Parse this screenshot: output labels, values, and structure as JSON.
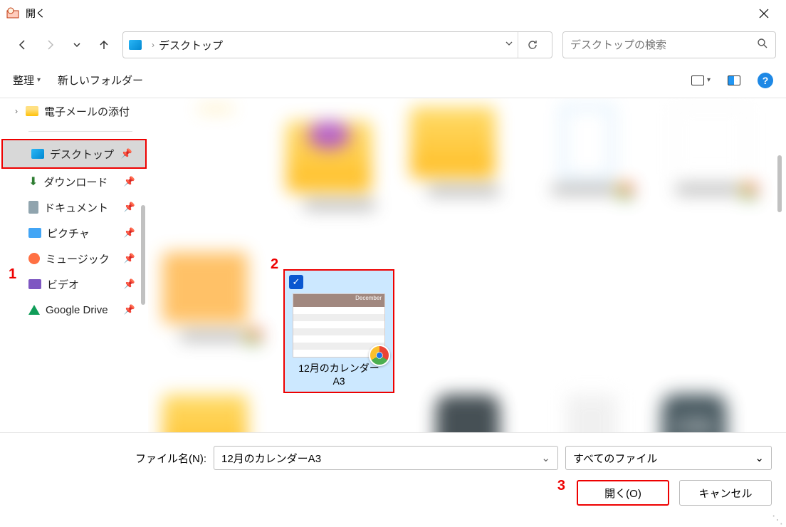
{
  "window": {
    "title": "開く"
  },
  "nav": {
    "path_location": "デスクトップ",
    "search_placeholder": "デスクトップの検索"
  },
  "toolbar": {
    "organize": "整理",
    "new_folder": "新しいフォルダー"
  },
  "sidebar": {
    "email_attach": "電子メールの添付",
    "desktop": "デスクトップ",
    "downloads": "ダウンロード",
    "documents": "ドキュメント",
    "pictures": "ピクチャ",
    "music": "ミュージック",
    "videos": "ビデオ",
    "gdrive": "Google Drive"
  },
  "selected": {
    "filename_line1": "12月のカレンダー",
    "filename_line2": "A3"
  },
  "bottom": {
    "file_label": "ファイル名(N):",
    "file_value": "12月のカレンダーA3",
    "filter": "すべてのファイル",
    "open": "開く(O)",
    "cancel": "キャンセル"
  },
  "annotations": {
    "a1": "1",
    "a2": "2",
    "a3": "3"
  }
}
